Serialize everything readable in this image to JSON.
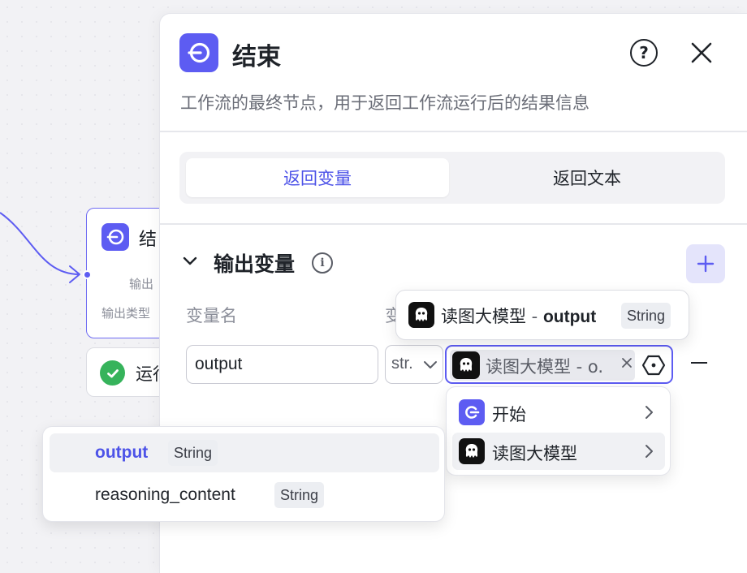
{
  "canvas_node": {
    "title": "结",
    "row1_label": "输出",
    "row2_label": "输出类型",
    "run_label": "运行"
  },
  "panel": {
    "title": "结束",
    "description": "工作流的最终节点，用于返回工作流运行后的结果信息",
    "help_glyph": "?",
    "tabs": [
      {
        "label": "返回变量",
        "active": true
      },
      {
        "label": "返回文本",
        "active": false
      }
    ],
    "section": {
      "title": "输出变量",
      "info_glyph": "i",
      "columns": [
        "变量名",
        "变"
      ]
    },
    "row": {
      "name_value": "output",
      "type_value": "str.",
      "reference_label": "读图大模型 - o."
    }
  },
  "tooltip": {
    "node": "读图大模型",
    "separator": " - ",
    "field": "output",
    "type_badge": "String"
  },
  "node_menu": {
    "items": [
      {
        "label": "开始",
        "icon": "start-node-icon",
        "color": "#5d5cf2"
      },
      {
        "label": "读图大模型",
        "icon": "vision-llm-icon",
        "color": "#111111"
      }
    ]
  },
  "field_menu": {
    "items": [
      {
        "name": "output",
        "type": "String",
        "selected": true
      },
      {
        "name": "reasoning_content",
        "type": "String",
        "selected": false
      }
    ]
  },
  "colors": {
    "accent": "#5d5cf2",
    "accent_text": "#4d53e8",
    "success": "#36b35b"
  }
}
